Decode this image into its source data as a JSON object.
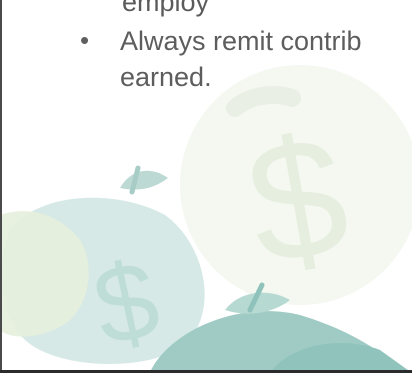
{
  "slide": {
    "partial_top_line": "employ",
    "bullet": {
      "line1": "Always remit contrib",
      "line2": "earned."
    }
  },
  "colors": {
    "text": "#5d5d5d",
    "art_teal": "#b9d8d4",
    "art_teal_dark": "#7fb8b1",
    "art_green": "#d9e8cc"
  },
  "icons": {
    "background_art": "dollar-apples-watermark"
  }
}
